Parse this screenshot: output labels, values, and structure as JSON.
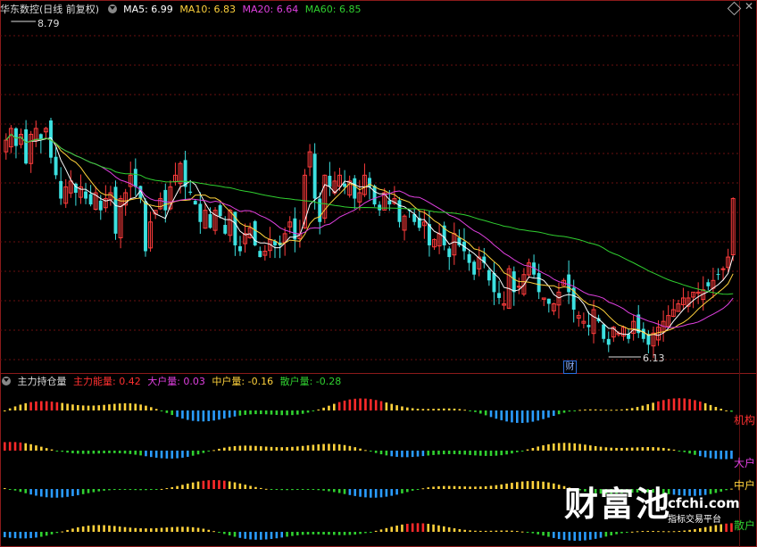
{
  "header": {
    "title": "华东数控(日线 前复权)",
    "ma": [
      {
        "label": "MA5: 6.99",
        "color": "#ffffff"
      },
      {
        "label": "MA10: 6.83",
        "color": "#ffd23c"
      },
      {
        "label": "MA20: 6.64",
        "color": "#e040e0"
      },
      {
        "label": "MA60: 6.85",
        "color": "#30d030"
      }
    ]
  },
  "price_labels": {
    "high": "8.79",
    "low": "6.13"
  },
  "badge": "财",
  "indicator": {
    "title": "主力持仓量",
    "items": [
      {
        "label": "主力能量: 0.42",
        "color": "#ff3030"
      },
      {
        "label": "大户量: 0.03",
        "color": "#e040e0"
      },
      {
        "label": "中户量: -0.16",
        "color": "#ffd23c"
      },
      {
        "label": "散户量: -0.28",
        "color": "#30d030"
      }
    ]
  },
  "side_labels": [
    {
      "label": "机构",
      "color": "#ff3030"
    },
    {
      "label": "大户",
      "color": "#e040e0"
    },
    {
      "label": "中户",
      "color": "#ffd23c"
    },
    {
      "label": "散户",
      "color": "#30d030"
    }
  ],
  "watermark": {
    "big": "财富池",
    "url": "cfchi.com",
    "sub": "指标交易平台"
  },
  "chart_data": {
    "type": "candlestick",
    "ylim": [
      6.0,
      8.9
    ],
    "ma": {
      "MA5": 6.99,
      "MA10": 6.83,
      "MA20": 6.64,
      "MA60": 6.85
    },
    "marked_high": 8.79,
    "marked_low": 6.13,
    "closes": [
      7.9,
      8.0,
      7.85,
      7.95,
      7.7,
      7.95,
      8.0,
      7.9,
      8.0,
      7.75,
      7.6,
      7.4,
      7.5,
      7.55,
      7.45,
      7.5,
      7.4,
      7.35,
      7.45,
      7.3,
      7.4,
      7.45,
      7.1,
      7.4,
      7.45,
      7.6,
      7.5,
      7.4,
      6.95,
      7.2,
      7.3,
      7.4,
      7.3,
      7.5,
      7.6,
      7.7,
      7.5,
      7.45,
      7.35,
      7.2,
      7.3,
      7.15,
      7.3,
      7.25,
      7.1,
      7.3,
      7.0,
      6.95,
      7.1,
      7.15,
      7.0,
      6.9,
      6.95,
      7.05,
      7.0,
      7.0,
      7.1,
      7.2,
      7.05,
      7.1,
      7.6,
      7.8,
      7.4,
      7.2,
      7.6,
      7.5,
      7.55,
      7.6,
      7.5,
      7.55,
      7.4,
      7.45,
      7.6,
      7.5,
      7.35,
      7.3,
      7.45,
      7.35,
      7.4,
      7.2,
      7.25,
      7.3,
      7.2,
      7.15,
      7.2,
      7.0,
      7.05,
      7.1,
      7.0,
      6.9,
      7.1,
      7.0,
      6.95,
      6.85,
      6.75,
      6.9,
      6.85,
      6.7,
      6.6,
      6.55,
      6.5,
      6.8,
      6.6,
      6.65,
      6.75,
      6.85,
      6.75,
      6.6,
      6.55,
      6.5,
      6.5,
      6.6,
      6.7,
      6.6,
      6.45,
      6.4,
      6.35,
      6.3,
      6.45,
      6.35,
      6.2,
      6.15,
      6.3,
      6.25,
      6.3,
      6.2,
      6.35,
      6.25,
      6.2,
      6.15,
      6.25,
      6.3,
      6.35,
      6.4,
      6.45,
      6.5,
      6.55,
      6.55,
      6.6,
      6.6,
      6.62,
      6.65,
      6.7,
      6.75,
      6.8,
      6.9,
      7.4
    ],
    "panels": [
      {
        "name": "主力能量",
        "value": 0.42
      },
      {
        "name": "大户量",
        "value": 0.03
      },
      {
        "name": "中户量",
        "value": -0.16
      },
      {
        "name": "散户量",
        "value": -0.28
      }
    ]
  }
}
